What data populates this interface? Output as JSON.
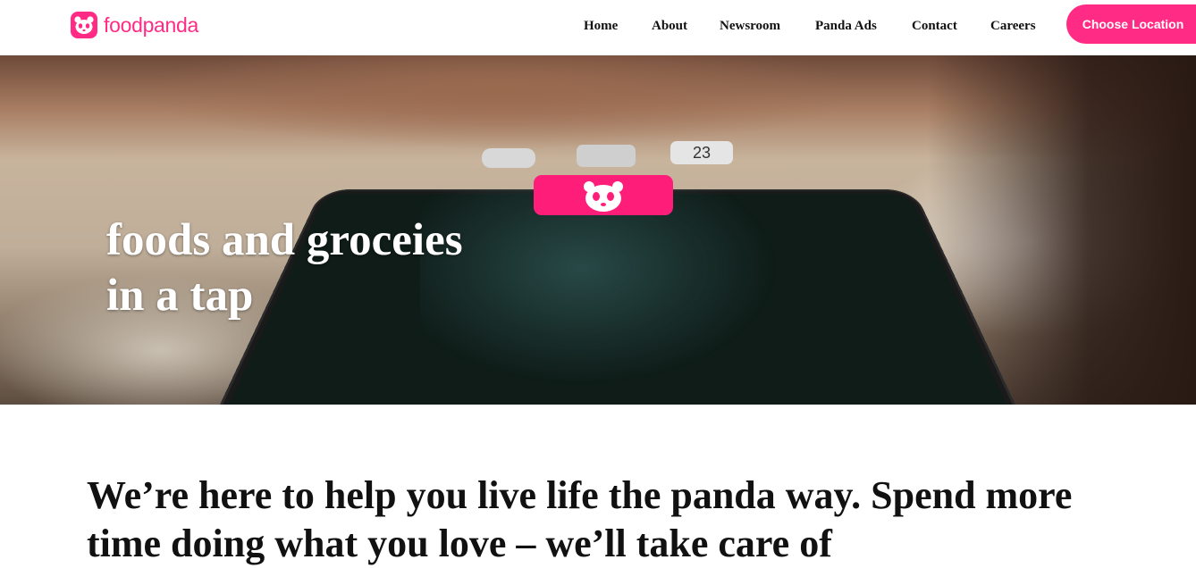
{
  "brand": {
    "name": "foodpanda",
    "color": "#ff2b85",
    "icon": "panda-logo-icon"
  },
  "nav": {
    "items": [
      {
        "label": "Home"
      },
      {
        "label": "About"
      },
      {
        "label": "Newsroom"
      },
      {
        "label": "Panda Ads"
      },
      {
        "label": "Contact"
      },
      {
        "label": "Careers"
      }
    ],
    "cta_label": "Choose Location"
  },
  "hero": {
    "title_line1": "foods and groceies",
    "title_line2": "in a tap",
    "calendar_icon_day": "23",
    "image_description_icons": [
      "clock-app-icon",
      "camera-app-icon",
      "calendar-app-icon",
      "foodpanda-app-icon"
    ]
  },
  "intro": {
    "text": "We’re here to help you live life the panda way. Spend more time doing what you love – we’ll take care of"
  }
}
